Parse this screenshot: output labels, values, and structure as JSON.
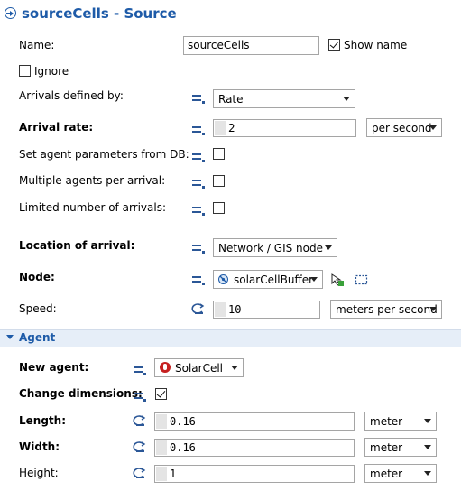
{
  "title": "sourceCells - Source",
  "name": {
    "label": "Name:",
    "value": "sourceCells",
    "show_name_label": "Show name",
    "show_name": true
  },
  "ignore": {
    "label": "Ignore",
    "checked": false
  },
  "arrivals_defined_by": {
    "label": "Arrivals defined by:",
    "value": "Rate"
  },
  "arrival_rate": {
    "label": "Arrival rate:",
    "value": "2",
    "unit": "per second"
  },
  "set_params_db": {
    "label": "Set agent parameters from DB:",
    "checked": false
  },
  "multiple_agents": {
    "label": "Multiple agents per arrival:",
    "checked": false
  },
  "limited_arrivals": {
    "label": "Limited number of arrivals:",
    "checked": false
  },
  "location_of_arrival": {
    "label": "Location of arrival:",
    "value": "Network / GIS node"
  },
  "node": {
    "label": "Node:",
    "value": "solarCellBuffer"
  },
  "speed": {
    "label": "Speed:",
    "value": "10",
    "unit": "meters per second"
  },
  "agent_section": {
    "title": "Agent"
  },
  "new_agent": {
    "label": "New agent:",
    "value": "SolarCell"
  },
  "change_dimensions": {
    "label": "Change dimensions:",
    "checked": true
  },
  "length": {
    "label": "Length:",
    "value": "0.16",
    "unit": "meter"
  },
  "width": {
    "label": "Width:",
    "value": "0.16",
    "unit": "meter"
  },
  "height": {
    "label": "Height:",
    "value": "1",
    "unit": "meter"
  },
  "colors": {
    "accent": "#1e5ba8",
    "section_bg": "#e6eef8",
    "agent_icon": "#c62020"
  },
  "icons": [
    "source-block-icon",
    "static-value-icon",
    "dynamic-value-icon",
    "agent-type-icon",
    "node-pin-icon",
    "select-node-icon",
    "zoom-to-node-icon"
  ]
}
